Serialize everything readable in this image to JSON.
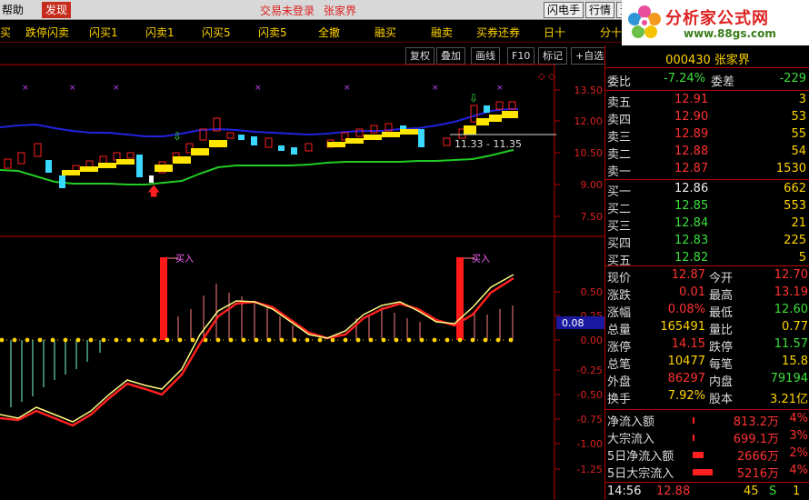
{
  "menubar": {
    "help": "帮助",
    "discover": "发现",
    "login_status": "交易未登录",
    "stock_name": "张家界",
    "btn_flash": "闪电手",
    "btn_quote": "行情",
    "btn_extra": "资"
  },
  "logo": {
    "title": "分析家公式网",
    "url": "www.88gs.com"
  },
  "toolbar": {
    "items": [
      "买",
      "跌停闪卖",
      "闪买1",
      "闪卖1",
      "闪买5",
      "闪卖5",
      "全撤",
      "融买",
      "融卖",
      "买券还券",
      "日十",
      "分十"
    ]
  },
  "chart_toolbar": {
    "restore_rights": "复权",
    "overlay": "叠加",
    "draw_line": "画线",
    "f10": "F10",
    "mark": "标记",
    "self_select": "+自选"
  },
  "main_chart": {
    "y_ticks": [
      "13.50",
      "12.00",
      "10.50",
      "9.00",
      "7.50"
    ],
    "range_label": "11.33 - 11.35"
  },
  "indicator_chart": {
    "y_ticks": [
      "0.50",
      "0.25",
      "0.00",
      "-0.25",
      "-0.50",
      "-0.75",
      "-1.00",
      "-1.25"
    ],
    "buy_label_1": "买入",
    "buy_label_2": "买入",
    "cursor_value": "0.08"
  },
  "quote": {
    "code": "000430",
    "name": "张家界",
    "weibi_label": "委比",
    "weibi": "-7.24%",
    "weicha_label": "委差",
    "weicha": "-229",
    "asks": [
      {
        "label": "卖五",
        "price": "12.91",
        "vol": "3"
      },
      {
        "label": "卖四",
        "price": "12.90",
        "vol": "53"
      },
      {
        "label": "卖三",
        "price": "12.89",
        "vol": "55"
      },
      {
        "label": "卖二",
        "price": "12.88",
        "vol": "54"
      },
      {
        "label": "卖一",
        "price": "12.87",
        "vol": "1530"
      }
    ],
    "bids": [
      {
        "label": "买一",
        "price": "12.86",
        "vol": "662"
      },
      {
        "label": "买二",
        "price": "12.85",
        "vol": "553"
      },
      {
        "label": "买三",
        "price": "12.84",
        "vol": "21"
      },
      {
        "label": "买四",
        "price": "12.83",
        "vol": "225"
      },
      {
        "label": "买五",
        "price": "12.82",
        "vol": "5"
      }
    ],
    "stats": [
      {
        "l1": "现价",
        "v1": "12.87",
        "l2": "今开",
        "v2": "12.70"
      },
      {
        "l1": "涨跌",
        "v1": "0.01",
        "l2": "最高",
        "v2": "13.19"
      },
      {
        "l1": "涨幅",
        "v1": "0.08%",
        "l2": "最低",
        "v2": "12.60"
      },
      {
        "l1": "总量",
        "v1": "165491",
        "l2": "量比",
        "v2": "0.77"
      },
      {
        "l1": "涨停",
        "v1": "14.15",
        "l2": "跌停",
        "v2": "11.57"
      },
      {
        "l1": "总笔",
        "v1": "10477",
        "l2": "每笔",
        "v2": "15.8"
      },
      {
        "l1": "外盘",
        "v1": "86297",
        "l2": "内盘",
        "v2": "79194"
      },
      {
        "l1": "换手",
        "v1": "7.92%",
        "l2": "股本",
        "v2": "3.21亿"
      }
    ],
    "flows": [
      {
        "label": "净流入额",
        "value": "813.2万",
        "pct": "4%",
        "bar": 2
      },
      {
        "label": "大宗流入",
        "value": "699.1万",
        "pct": "3%",
        "bar": 2
      },
      {
        "label": "5日净流入额",
        "value": "2666万",
        "pct": "2%",
        "bar": 12
      },
      {
        "label": "5日大宗流入",
        "value": "5216万",
        "pct": "4%",
        "bar": 22
      }
    ],
    "bottom": {
      "time": "14:56",
      "price": "12.88",
      "vol": "45",
      "side": "S",
      "count": "1"
    }
  }
}
